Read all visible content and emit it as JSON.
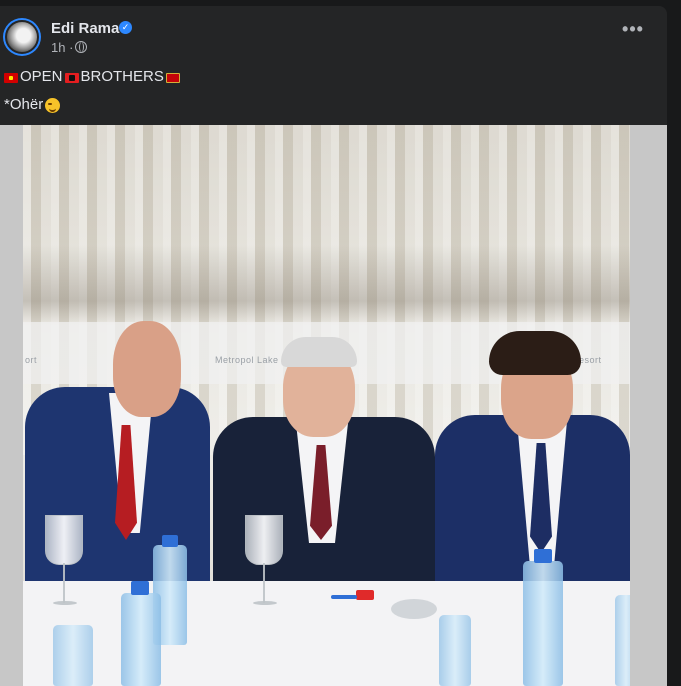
{
  "post": {
    "author": "Edi Rama",
    "timestamp": "1h",
    "separator": "·",
    "more_label": "•••",
    "text_line1_words": [
      "OPEN",
      "BROTHERS"
    ],
    "text_line2": "*Ohër",
    "icons": {
      "avatar": "profile-photo",
      "verified": "verified-badge-icon",
      "audience": "globe-icon",
      "more": "more-options-icon",
      "emoji": [
        "macedonia-flag",
        "albania-flag",
        "montenegro-flag",
        "wink-emoji"
      ]
    }
  },
  "photo": {
    "banner_left": "ort",
    "banner_center": "Metropol Lake",
    "banner_right": "ake Resort"
  },
  "colors": {
    "background": "#18191a",
    "card": "#242526",
    "text": "#e4e6eb",
    "secondary_text": "#b0b3b8",
    "accent": "#2d88ff"
  }
}
